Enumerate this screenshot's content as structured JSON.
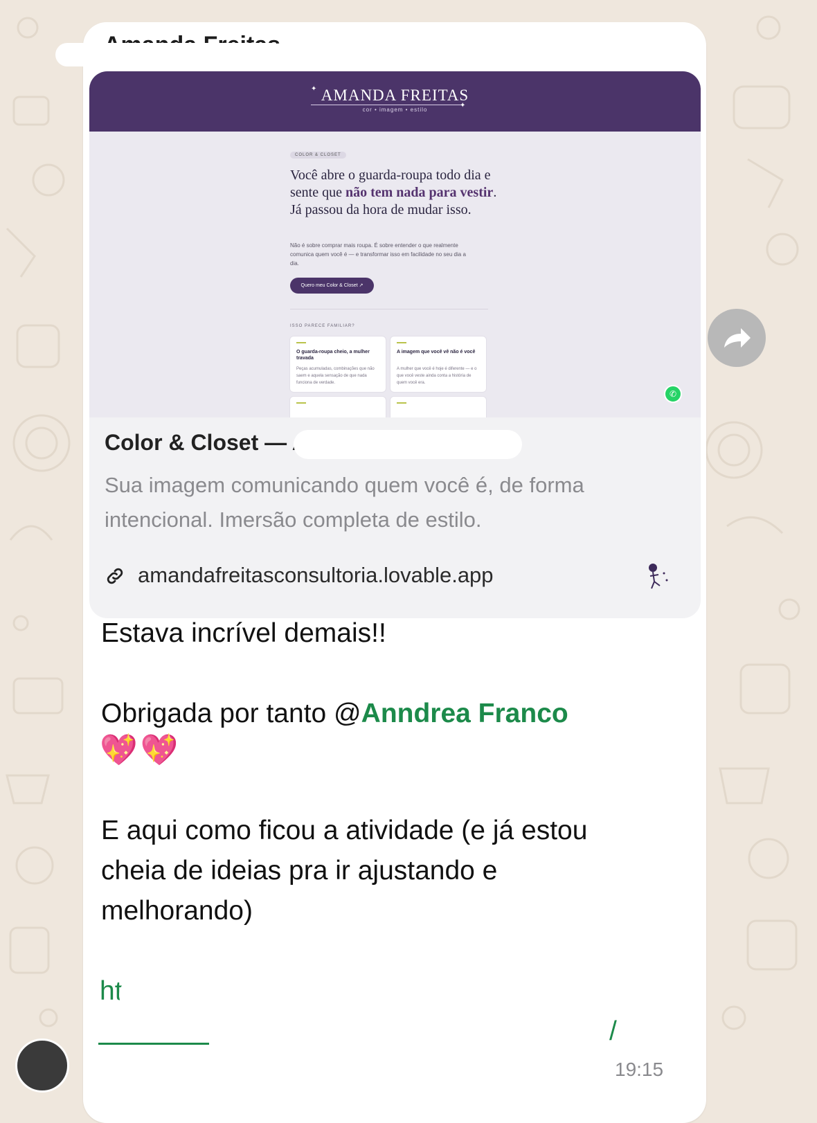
{
  "chat": {
    "sender_name": "Amanda Freitas",
    "link_preview": {
      "site": {
        "logo": "AMANDA FREITAS",
        "tagline": "cor  •  imagem  •  estilo",
        "pill": "COLOR & CLOSET",
        "hero_part1": "Você abre o guarda-roupa todo dia e sente que ",
        "hero_bold": "não tem nada para vestir",
        "hero_part2": ". Já passou da hora de mudar isso.",
        "hero_sub": "Não é sobre comprar mais roupa. É sobre entender o que realmente comunica quem você é — e transformar isso em facilidade no seu dia a dia.",
        "cta": "Quero meu Color & Closet ↗",
        "section_label": "ISSO PARECE FAMILIAR?",
        "cards": [
          {
            "title": "O guarda-roupa cheio, a mulher travada",
            "text": "Peças acumuladas, combinações que não saem e aquela sensação de que nada funciona de verdade."
          },
          {
            "title": "A imagem que você vê não é você",
            "text": "A mulher que você é hoje é diferente — e o que você veste ainda conta a história de quem você era."
          },
          {
            "title": "",
            "text": ""
          },
          {
            "title": "",
            "text": ""
          }
        ]
      },
      "title": "Color & Closet — Amanda Freitas",
      "description": "Sua imagem comunicando quem você é, de forma intencional. Imersão completa de estilo.",
      "url": "amandafreitasconsultoria.lovable.app"
    },
    "message": {
      "line1": "Estava incrível demais!!",
      "line2_prefix": "Obrigada por tanto @",
      "mention": "Anndrea Franco",
      "emojis": "💖💖",
      "line3a": "E aqui como ficou a atividade (e já estou",
      "line3b": "cheia de ideias pra ir ajustando e",
      "line3c": "melhorando)",
      "link_part1": "https://",
      "link_part2": "/"
    },
    "time": "19:15"
  },
  "colors": {
    "wallpaper": "#efe7dd",
    "site_purple": "#4b3469",
    "mention_green": "#1c8a4a",
    "forward_button": "#b8b8b8"
  },
  "icons": [
    "link-icon",
    "forward-icon",
    "whatsapp-icon",
    "favicon-icon"
  ]
}
